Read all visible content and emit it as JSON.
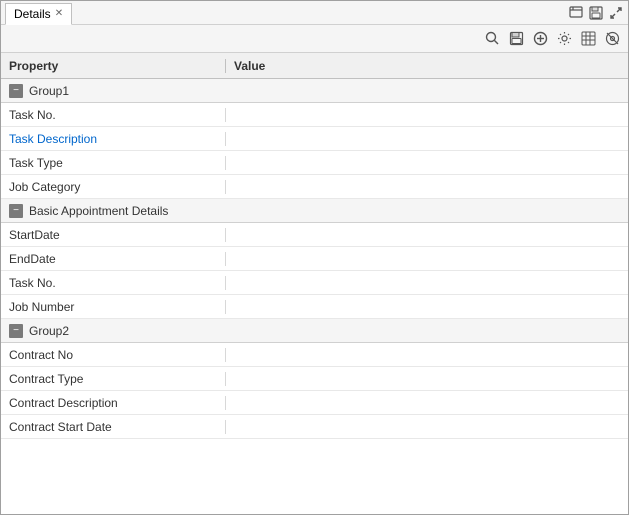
{
  "window": {
    "tab_label": "Details",
    "title_icons": {
      "edit": "✎",
      "save": "▣",
      "close": "✕"
    }
  },
  "toolbar": {
    "search_icon": "🔍",
    "save_icon": "💾",
    "add_icon": "+",
    "settings_icon": "⚙",
    "export_icon": "▦",
    "hide_icon": "◎"
  },
  "table": {
    "col_property_label": "Property",
    "col_value_label": "Value",
    "rows": [
      {
        "type": "group",
        "label": "Group1"
      },
      {
        "type": "data",
        "property": "Task No.",
        "value": "",
        "link": false
      },
      {
        "type": "data",
        "property": "Task Description",
        "value": "",
        "link": true
      },
      {
        "type": "data",
        "property": "Task Type",
        "value": "",
        "link": false
      },
      {
        "type": "data",
        "property": "Job Category",
        "value": "",
        "link": false
      },
      {
        "type": "group",
        "label": "Basic Appointment Details"
      },
      {
        "type": "data",
        "property": "StartDate",
        "value": "",
        "link": false
      },
      {
        "type": "data",
        "property": "EndDate",
        "value": "",
        "link": false
      },
      {
        "type": "data",
        "property": "Task No.",
        "value": "",
        "link": false
      },
      {
        "type": "data",
        "property": "Job Number",
        "value": "",
        "link": false
      },
      {
        "type": "group",
        "label": "Group2"
      },
      {
        "type": "data",
        "property": "Contract No",
        "value": "",
        "link": false
      },
      {
        "type": "data",
        "property": "Contract Type",
        "value": "",
        "link": false
      },
      {
        "type": "data",
        "property": "Contract Description",
        "value": "",
        "link": false
      },
      {
        "type": "data",
        "property": "Contract Start Date",
        "value": "",
        "link": false
      }
    ]
  }
}
